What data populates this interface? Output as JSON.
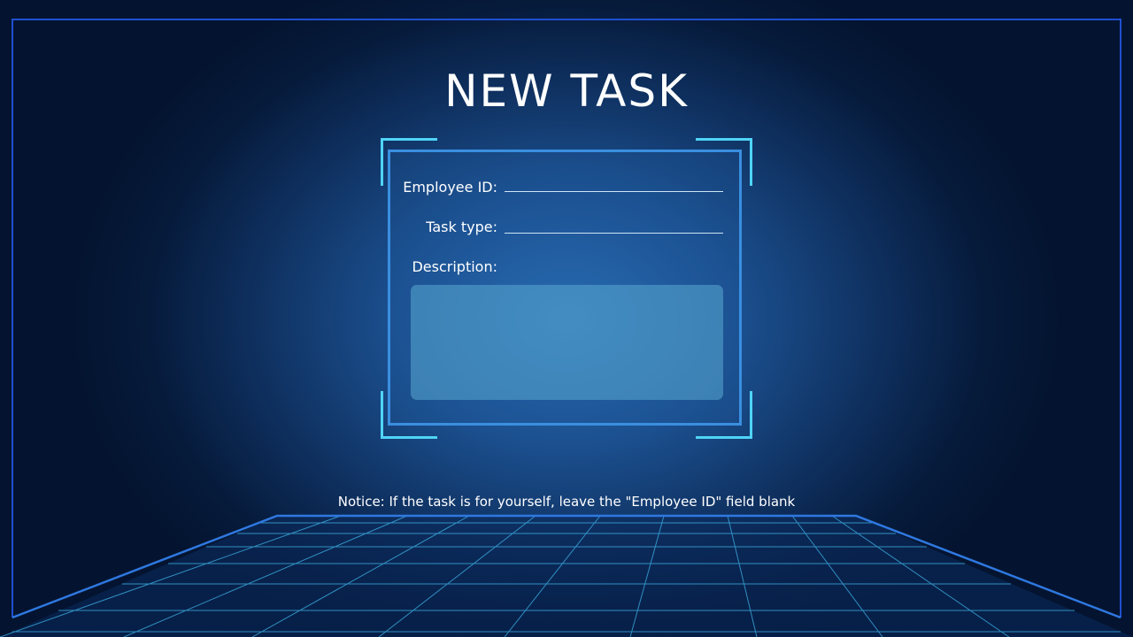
{
  "title": "NEW TASK",
  "form": {
    "employee_id": {
      "label": "Employee ID:",
      "value": ""
    },
    "task_type": {
      "label": "Task type:",
      "value": ""
    },
    "description": {
      "label": "Description:",
      "value": ""
    }
  },
  "notice": "Notice: If the task is for yourself, leave the \"Employee ID\" field blank",
  "colors": {
    "frame": "#1f4fd0",
    "panel_border": "#3a8fe0",
    "corner_brackets": "#4fd4f6",
    "grid_lines": "#3fb4e8",
    "description_fill": "#4a90bf"
  }
}
